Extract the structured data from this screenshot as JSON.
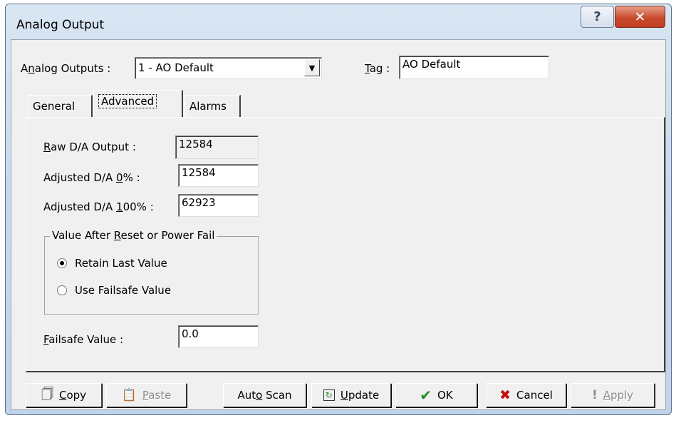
{
  "window": {
    "title": "Analog Output",
    "help_glyph": "?",
    "close_glyph": "✕"
  },
  "selector": {
    "analog_outputs_label_pre": "A",
    "analog_outputs_label_u": "n",
    "analog_outputs_label_post": "alog Outputs :",
    "analog_outputs_value": "1 - AO Default",
    "tag_label_u": "T",
    "tag_label_post": "ag :",
    "tag_value": "AO Default"
  },
  "tabs": [
    {
      "label": "General"
    },
    {
      "label": "Advanced",
      "active": true
    },
    {
      "label": "Alarms"
    }
  ],
  "advanced": {
    "raw_label_u": "R",
    "raw_label_post": "aw D/A Output :",
    "raw_value": "12584",
    "adj0_label_pre": "Adjusted D/A ",
    "adj0_label_u": "0",
    "adj0_label_post": "% :",
    "adj0_value": "12584",
    "adj100_label_pre": "Adjusted D/A ",
    "adj100_label_u": "1",
    "adj100_label_post": "00% :",
    "adj100_value": "62923",
    "group_title_pre": "Value After ",
    "group_title_u": "R",
    "group_title_post": "eset or Power Fail",
    "radio_retain_label": "Retain Last Value",
    "radio_failsafe_label": "Use Failsafe Value",
    "failsafe_label_u": "F",
    "failsafe_label_post": "ailsafe Value :",
    "failsafe_value": "0.0"
  },
  "buttons": {
    "copy_u": "C",
    "copy_post": "opy",
    "paste_u": "P",
    "paste_post": "aste",
    "autoscan_pre": "Aut",
    "autoscan_u": "o",
    "autoscan_post": " Scan",
    "update_u": "U",
    "update_post": "pdate",
    "ok": "OK",
    "cancel": "Cancel",
    "apply_u": "A",
    "apply_post": "pply"
  },
  "colors": {
    "ok_check": "#1f8a1f",
    "cancel_x": "#c01010",
    "close_button": "#c94b2f"
  }
}
